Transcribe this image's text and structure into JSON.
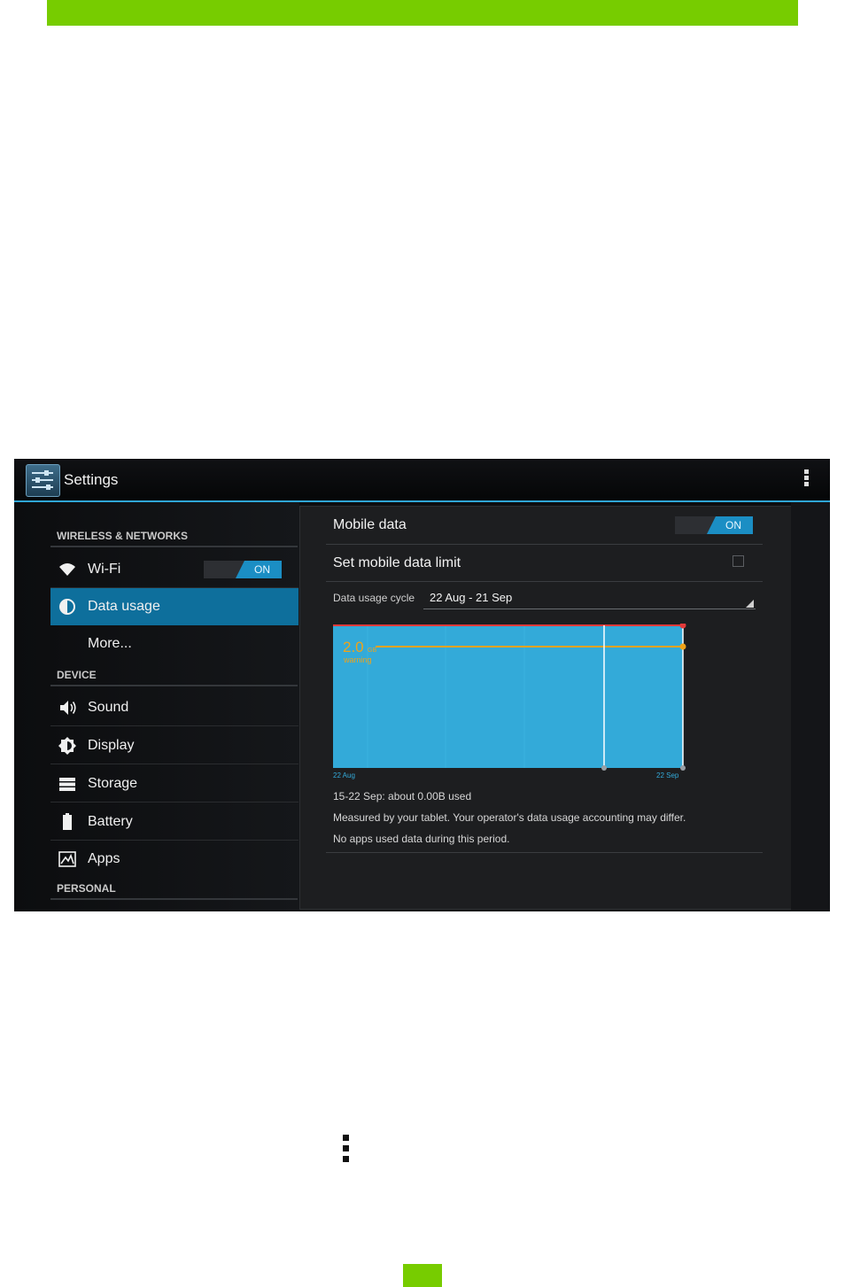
{
  "app": {
    "title": "Settings"
  },
  "sidebar": {
    "sections": [
      {
        "header": "WIRELESS & NETWORKS"
      },
      {
        "header": "DEVICE"
      },
      {
        "header": "PERSONAL"
      }
    ],
    "items": [
      {
        "label": "Wi-Fi",
        "icon": "wifi-icon",
        "toggle": "ON"
      },
      {
        "label": "Data usage",
        "icon": "data-usage-icon",
        "selected": true
      },
      {
        "label": "More..."
      },
      {
        "label": "Sound",
        "icon": "speaker-icon"
      },
      {
        "label": "Display",
        "icon": "brightness-icon"
      },
      {
        "label": "Storage",
        "icon": "storage-icon"
      },
      {
        "label": "Battery",
        "icon": "battery-icon"
      },
      {
        "label": "Apps",
        "icon": "apps-icon"
      }
    ]
  },
  "detail": {
    "mobile_data": {
      "label": "Mobile data",
      "toggle": "ON"
    },
    "data_limit": {
      "label": "Set mobile data limit",
      "checked": false
    },
    "cycle": {
      "label": "Data usage cycle",
      "value": "22 Aug - 21 Sep"
    },
    "summary": [
      "15-22 Sep: about 0.00B used",
      "Measured by your tablet. Your operator's data usage accounting may differ.",
      "No apps used data during this period."
    ]
  },
  "chart_data": {
    "type": "area",
    "x_start_label": "22 Aug",
    "x_end_label": "22 Sep",
    "warning_value": "2.0",
    "warning_unit": "GB",
    "warning_label": "warning",
    "colors": {
      "fill": "#33aad9",
      "warning": "#f0a318",
      "limit": "#e23a3a",
      "marker": "#ffffff"
    }
  },
  "colors": {
    "accent": "#2fa6d6",
    "selected_bg": "#0e6f9c",
    "brand_bar": "#77cc00"
  }
}
